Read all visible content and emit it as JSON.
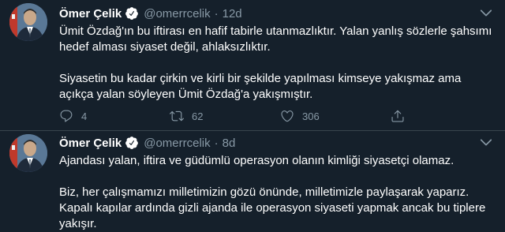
{
  "tweets": [
    {
      "author_name": "Ömer Çelik",
      "handle": "@omerrcelik",
      "separator": "·",
      "time": "12d",
      "paragraphs": [
        "Ümit Özdağ'ın bu iftirası en hafif tabirle utanmazlıktır. Yalan yanlış sözlerle şahsımı hedef alması siyaset değil, ahlaksızlıktır.",
        "Siyasetin bu kadar çirkin ve kirli bir şekilde yapılması kimseye yakışmaz ama açıkça yalan söyleyen Ümit Özdağ'a yakışmıştır."
      ],
      "reply_count": "4",
      "retweet_count": "62",
      "like_count": "306"
    },
    {
      "author_name": "Ömer Çelik",
      "handle": "@omerrcelik",
      "separator": "·",
      "time": "8d",
      "paragraphs": [
        "Ajandası yalan, iftira ve güdümlü operasyon olanın kimliği siyasetçi olamaz.",
        "Biz, her çalışmamızı milletimizin gözü önünde, milletimizle paylaşarak yaparız. Kapalı kapılar ardında gizli ajanda ile operasyon siyaseti yapmak ancak bu tiplere yakışır."
      ]
    }
  ],
  "colors": {
    "background": "#15202b",
    "secondary_text": "#8899a6",
    "divider": "#38444d",
    "verified_badge": "#ffffff"
  },
  "icons": [
    "verified-icon",
    "caret-down-icon",
    "reply-icon",
    "retweet-icon",
    "like-icon",
    "share-icon"
  ]
}
